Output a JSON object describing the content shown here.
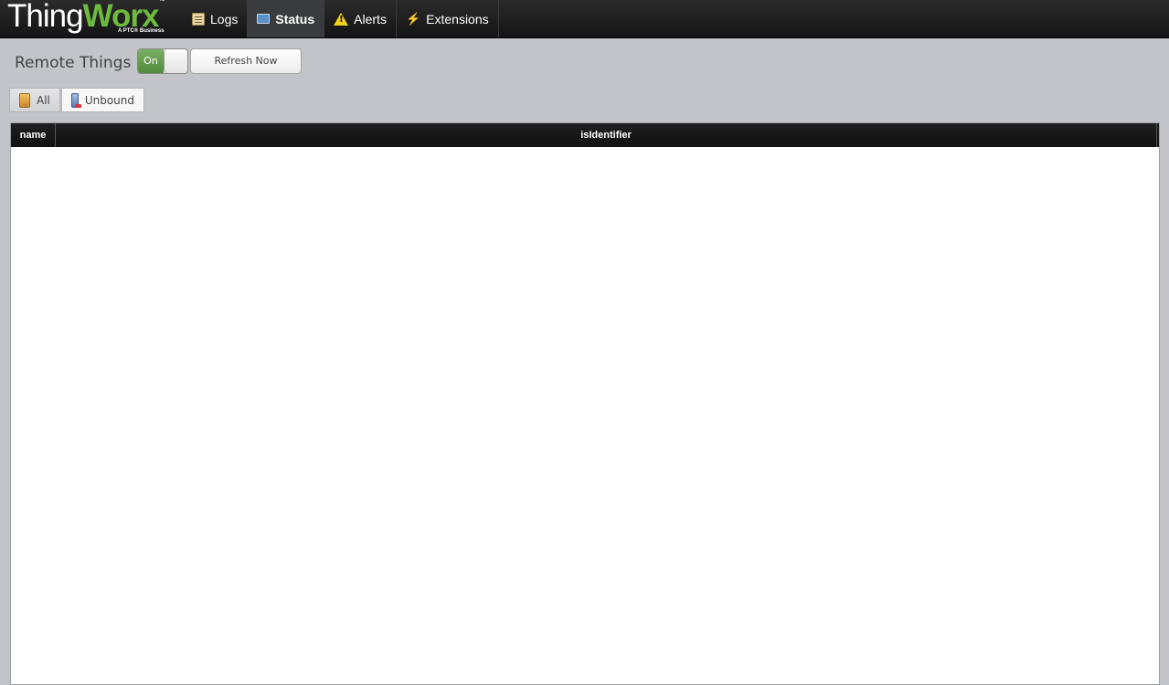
{
  "header": {
    "logo": {
      "part1": "Thing",
      "part2": "Worx",
      "tm": "™",
      "subtitle": "A PTC® Business"
    },
    "nav": [
      {
        "label": "Logs",
        "icon": "clipboard-icon"
      },
      {
        "label": "Status",
        "icon": "monitor-icon",
        "active": true
      },
      {
        "label": "Alerts",
        "icon": "warning-icon"
      },
      {
        "label": "Extensions",
        "icon": "plug-icon"
      }
    ]
  },
  "main": {
    "title": "Remote Things",
    "auto_refresh": {
      "state_label": "On",
      "checked": true
    },
    "refresh_label": "Refresh Now",
    "filters": [
      {
        "label": "All",
        "icon": "all-things-icon",
        "selected": true
      },
      {
        "label": "Unbound",
        "icon": "unbound-thing-icon",
        "selected": false
      }
    ],
    "grid": {
      "columns": [
        "name",
        "isIdentifier"
      ],
      "rows": []
    }
  },
  "colors": {
    "brand_green": "#6dbb3f",
    "toggle_green": "#5f9a4a",
    "topbar": "#1a1a1a",
    "page_bg": "#c3c4c9"
  }
}
